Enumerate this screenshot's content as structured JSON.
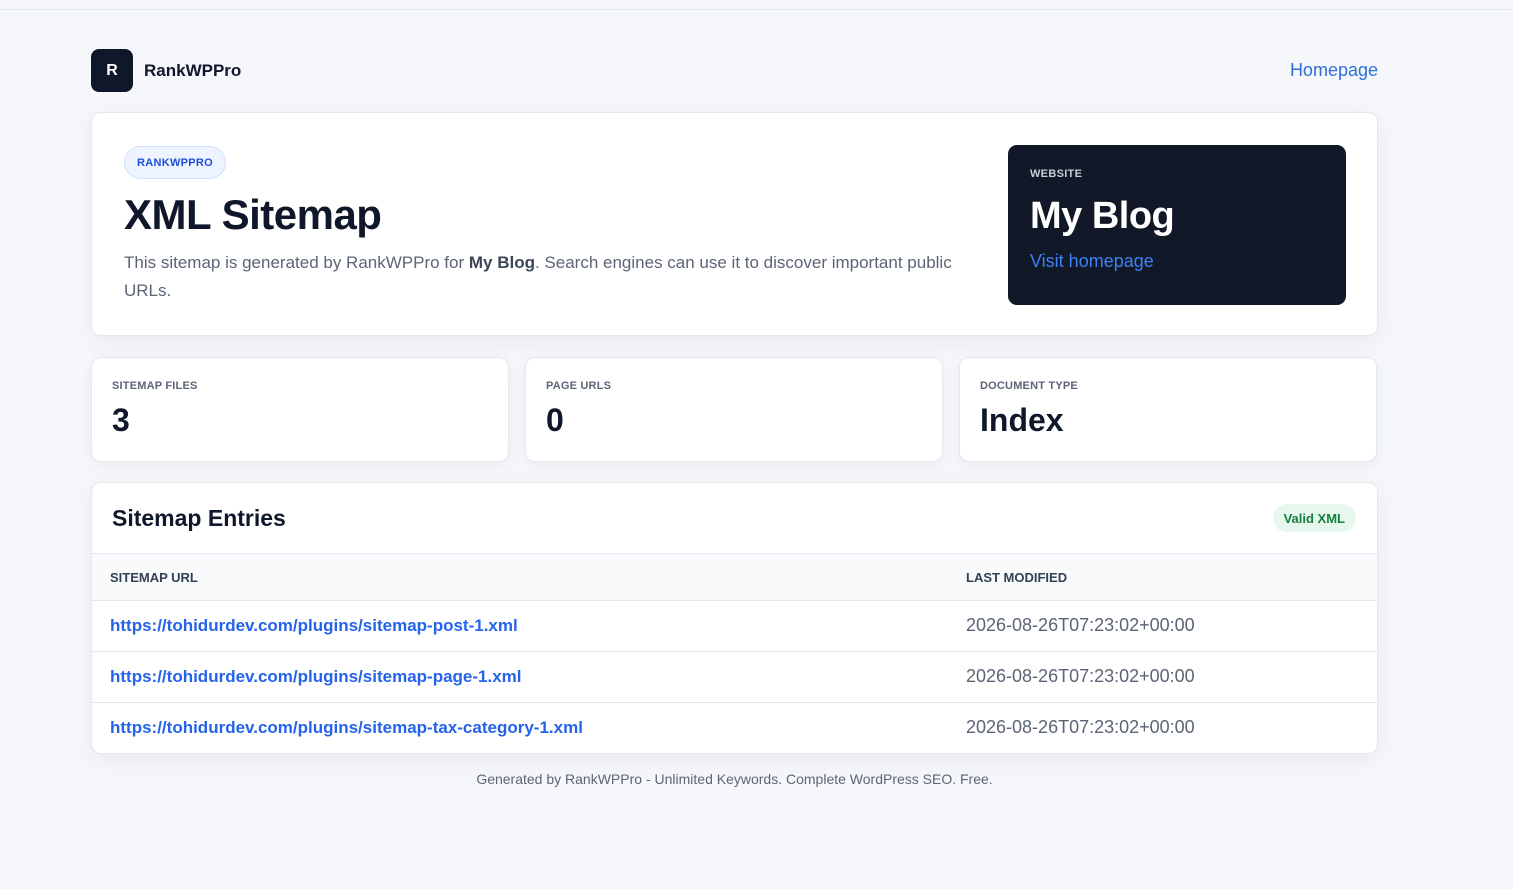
{
  "header": {
    "logo_letter": "R",
    "brand": "RankWPPro",
    "homepage_link": "Homepage"
  },
  "hero": {
    "pill": "RANKWPPRO",
    "title": "XML Sitemap",
    "desc_prefix": "This sitemap is generated by RankWPPro for ",
    "desc_site": "My Blog",
    "desc_suffix": ". Search engines can use it to discover important public URLs.",
    "site_label": "WEBSITE",
    "site_name": "My Blog",
    "site_link": "Visit homepage"
  },
  "stats": [
    {
      "label": "SITEMAP FILES",
      "value": "3"
    },
    {
      "label": "PAGE URLS",
      "value": "0"
    },
    {
      "label": "DOCUMENT TYPE",
      "value": "Index"
    }
  ],
  "entries": {
    "title": "Sitemap Entries",
    "badge": "Valid XML",
    "columns": [
      "SITEMAP URL",
      "LAST MODIFIED"
    ],
    "rows": [
      {
        "url": "https://tohidurdev.com/plugins/sitemap-post-1.xml",
        "modified": "2026-08-26T07:23:02+00:00"
      },
      {
        "url": "https://tohidurdev.com/plugins/sitemap-page-1.xml",
        "modified": "2026-08-26T07:23:02+00:00"
      },
      {
        "url": "https://tohidurdev.com/plugins/sitemap-tax-category-1.xml",
        "modified": "2026-08-26T07:23:02+00:00"
      }
    ]
  },
  "footer": "Generated by RankWPPro - Unlimited Keywords. Complete WordPress SEO. Free.",
  "colors": {
    "accent": "#2563eb",
    "dark": "#0f172a",
    "success": "#15803d"
  }
}
